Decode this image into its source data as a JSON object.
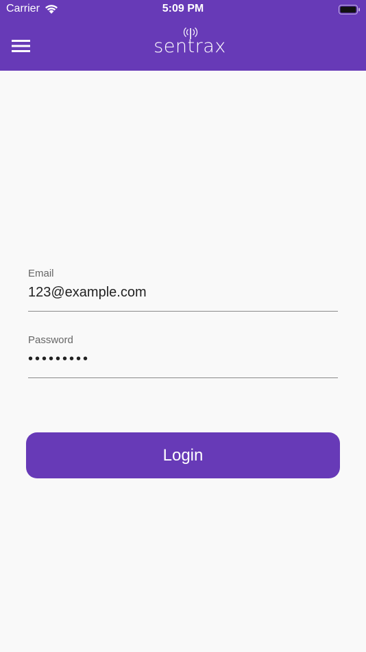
{
  "status_bar": {
    "carrier": "Carrier",
    "time": "5:09 PM"
  },
  "header": {
    "logo_text": "sentrax",
    "menu_icon": "hamburger-menu-icon",
    "background_color": "#673ab7"
  },
  "login_form": {
    "email": {
      "label": "Email",
      "value": "123@example.com"
    },
    "password": {
      "label": "Password",
      "value": "•••••••••"
    },
    "login_button_label": "Login"
  },
  "colors": {
    "accent": "#673ab7",
    "background": "#f9f9f9"
  }
}
